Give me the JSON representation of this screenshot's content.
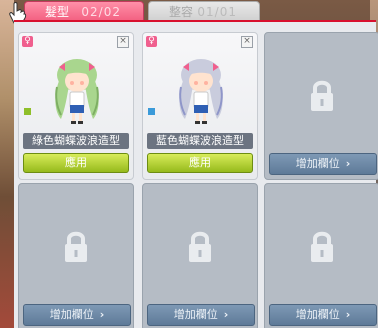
{
  "tabs": [
    {
      "label": "髮型",
      "count": "02/02"
    },
    {
      "label": "整容",
      "count": "01/01"
    }
  ],
  "slots": [
    {
      "state": "filled",
      "name": "綠色蝴蝶波浪造型",
      "action": "應用",
      "hair_color": "#a9d68e",
      "hair_shade": "#7eaf63",
      "swatch_color": "#8fbf2a",
      "icons": [
        "female-icon",
        "close-icon"
      ]
    },
    {
      "state": "filled",
      "name": "藍色蝴蝶波浪造型",
      "action": "應用",
      "hair_color": "#c9ccdd",
      "hair_shade": "#8f96c9",
      "swatch_color": "#3b9ad9",
      "icons": [
        "female-icon",
        "close-icon"
      ]
    },
    {
      "state": "locked",
      "action": "增加欄位",
      "icons": [
        "lock-icon"
      ]
    },
    {
      "state": "locked",
      "action": "增加欄位",
      "icons": [
        "lock-icon"
      ]
    },
    {
      "state": "locked",
      "action": "增加欄位",
      "icons": [
        "lock-icon"
      ]
    },
    {
      "state": "locked",
      "action": "增加欄位",
      "icons": [
        "lock-icon"
      ]
    }
  ],
  "colors": {
    "accent": "#d8102e",
    "active_tab": "#f25d7e",
    "apply_button": "#a8c82a",
    "add_button": "#6b86a3"
  }
}
